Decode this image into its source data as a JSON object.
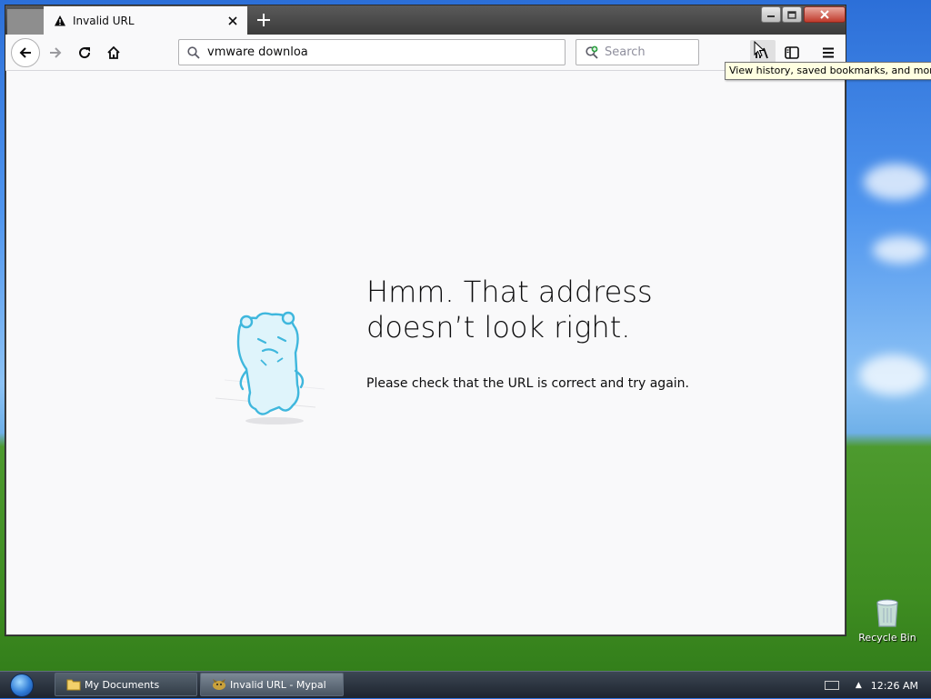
{
  "browser": {
    "tab": {
      "title": "Invalid URL"
    },
    "url_value": "vmware downloa",
    "search_placeholder": "Search",
    "tooltip": "View history, saved bookmarks, and more",
    "error": {
      "title": "Hmm. That address doesn’t look right.",
      "message": "Please check that the URL is correct and try again."
    }
  },
  "desktop": {
    "recycle_bin_label": "Recycle Bin"
  },
  "taskbar": {
    "tasks": [
      {
        "label": "My Documents",
        "icon": "folder-icon"
      },
      {
        "label": "Invalid URL - Mypal",
        "icon": "mypal-icon"
      }
    ],
    "clock": "12:26 AM"
  },
  "colors": {
    "accent": "#0a84ff",
    "illustration": "#7fd0ec"
  }
}
